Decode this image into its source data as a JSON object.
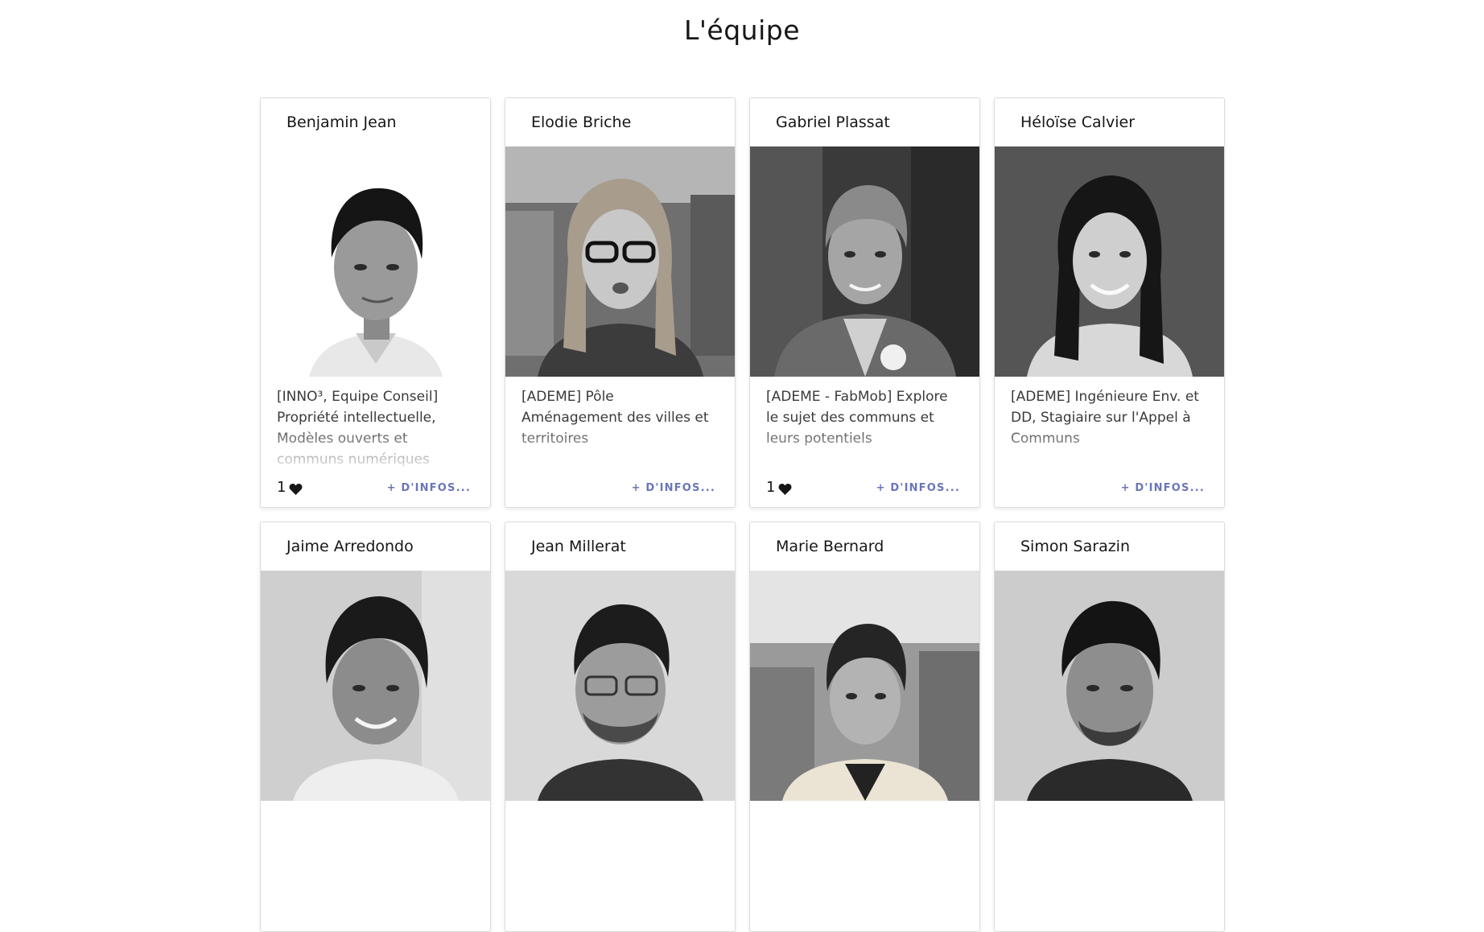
{
  "page": {
    "title": "L'équipe"
  },
  "cards": [
    {
      "name": "Benjamin Jean",
      "description": "[INNO³, Equipe Conseil] Propriété intellectuelle, Modèles ouverts et communs numériques",
      "likes": "1",
      "more": "+ D'INFOS..."
    },
    {
      "name": "Elodie Briche",
      "description": "[ADEME] Pôle Aménagement des villes et territoires",
      "likes": "",
      "more": "+ D'INFOS..."
    },
    {
      "name": "Gabriel Plassat",
      "description": "[ADEME - FabMob] Explore le sujet des communs et leurs potentiels",
      "likes": "1",
      "more": "+ D'INFOS..."
    },
    {
      "name": "Héloïse Calvier",
      "description": "[ADEME] Ingénieure Env. et DD, Stagiaire sur l'Appel à Communs",
      "likes": "",
      "more": "+ D'INFOS..."
    },
    {
      "name": "Jaime Arredondo",
      "description": "",
      "likes": "",
      "more": ""
    },
    {
      "name": "Jean Millerat",
      "description": "",
      "likes": "",
      "more": ""
    },
    {
      "name": "Marie Bernard",
      "description": "",
      "likes": "",
      "more": ""
    },
    {
      "name": "Simon Sarazin",
      "description": "",
      "likes": "",
      "more": ""
    }
  ],
  "icons": {
    "like": "heart-icon"
  },
  "colors": {
    "link": "#6a76b8",
    "text": "#161616"
  }
}
